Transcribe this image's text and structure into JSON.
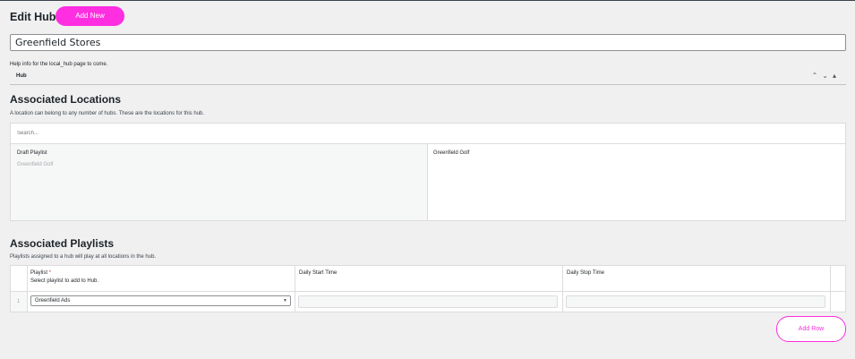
{
  "header": {
    "title": "Edit Hub",
    "add_new_label": "Add New"
  },
  "title_field": {
    "value": "Greenfield Stores"
  },
  "help": {
    "text": "Help info for the local_hub page to come."
  },
  "hub_panel": {
    "label": "Hub",
    "controls": {
      "up": "⌃",
      "down": "⌄",
      "toggle": "▴"
    }
  },
  "locations": {
    "title": "Associated Locations",
    "description": "A location can belong to any number of hubs. These are the locations for this hub.",
    "search_placeholder": "Search...",
    "left_column": {
      "heading": "Draft Playlist",
      "items": [
        "Greenfield Golf"
      ]
    },
    "right_column": {
      "items": [
        "Greenfield Golf"
      ]
    }
  },
  "playlists": {
    "title": "Associated Playlists",
    "description": "Playlists assigned to a hub will play at all locations in the hub.",
    "columns": {
      "playlist": {
        "label": "Playlist",
        "required_mark": "*",
        "instructions": "Select playlist to add to Hub."
      },
      "start": {
        "label": "Daily Start Time"
      },
      "stop": {
        "label": "Daily Stop Time"
      }
    },
    "rows": [
      {
        "index": "1",
        "playlist": "Greenfield Ads",
        "start": "",
        "stop": ""
      }
    ],
    "add_row_label": "Add Row"
  },
  "colors": {
    "accent": "#ff2ee1",
    "background": "#f0f0f1"
  }
}
